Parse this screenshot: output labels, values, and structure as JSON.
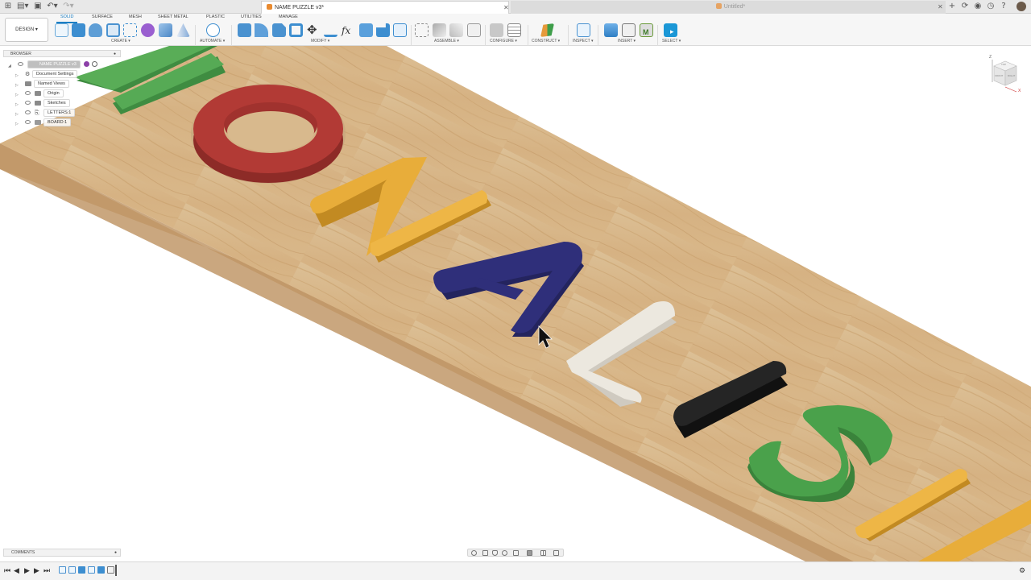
{
  "window": {
    "active_tab": "NAME PUZZLE v3*",
    "inactive_tab": "Untitled*"
  },
  "toolbar": {
    "workspace_button": "DESIGN ▾",
    "workspace_tabs": [
      "SOLID",
      "SURFACE",
      "MESH",
      "SHEET METAL",
      "PLASTIC",
      "UTILITIES",
      "MANAGE"
    ],
    "groups": [
      "CREATE ▾",
      "AUTOMATE ▾",
      "MODIFY ▾",
      "ASSEMBLE ▾",
      "CONFIGURE ▾",
      "CONSTRUCT ▾",
      "INSPECT ▾",
      "INSERT ▾",
      "SELECT ▾"
    ]
  },
  "browser": {
    "title": "BROWSER",
    "root": "NAME PUZZLE v3",
    "items": [
      "Document Settings",
      "Named Views",
      "Origin",
      "Sketches",
      "LETTERS:1",
      "BOARD:1"
    ]
  },
  "comments": {
    "title": "COMMENTS"
  },
  "viewcube": {
    "labels": [
      "TOP",
      "FRONT",
      "RIGHT"
    ],
    "axes": [
      "Z",
      "X"
    ]
  },
  "colors": {
    "accent": "#1b7fc4",
    "wood": "#d9b98a",
    "letter_red": "#b23a35",
    "letter_yellow": "#e8ad3a",
    "letter_navy": "#2f2f7a",
    "letter_white": "#ece8df",
    "letter_black": "#1e1e1e",
    "letter_green": "#4aa14b"
  }
}
